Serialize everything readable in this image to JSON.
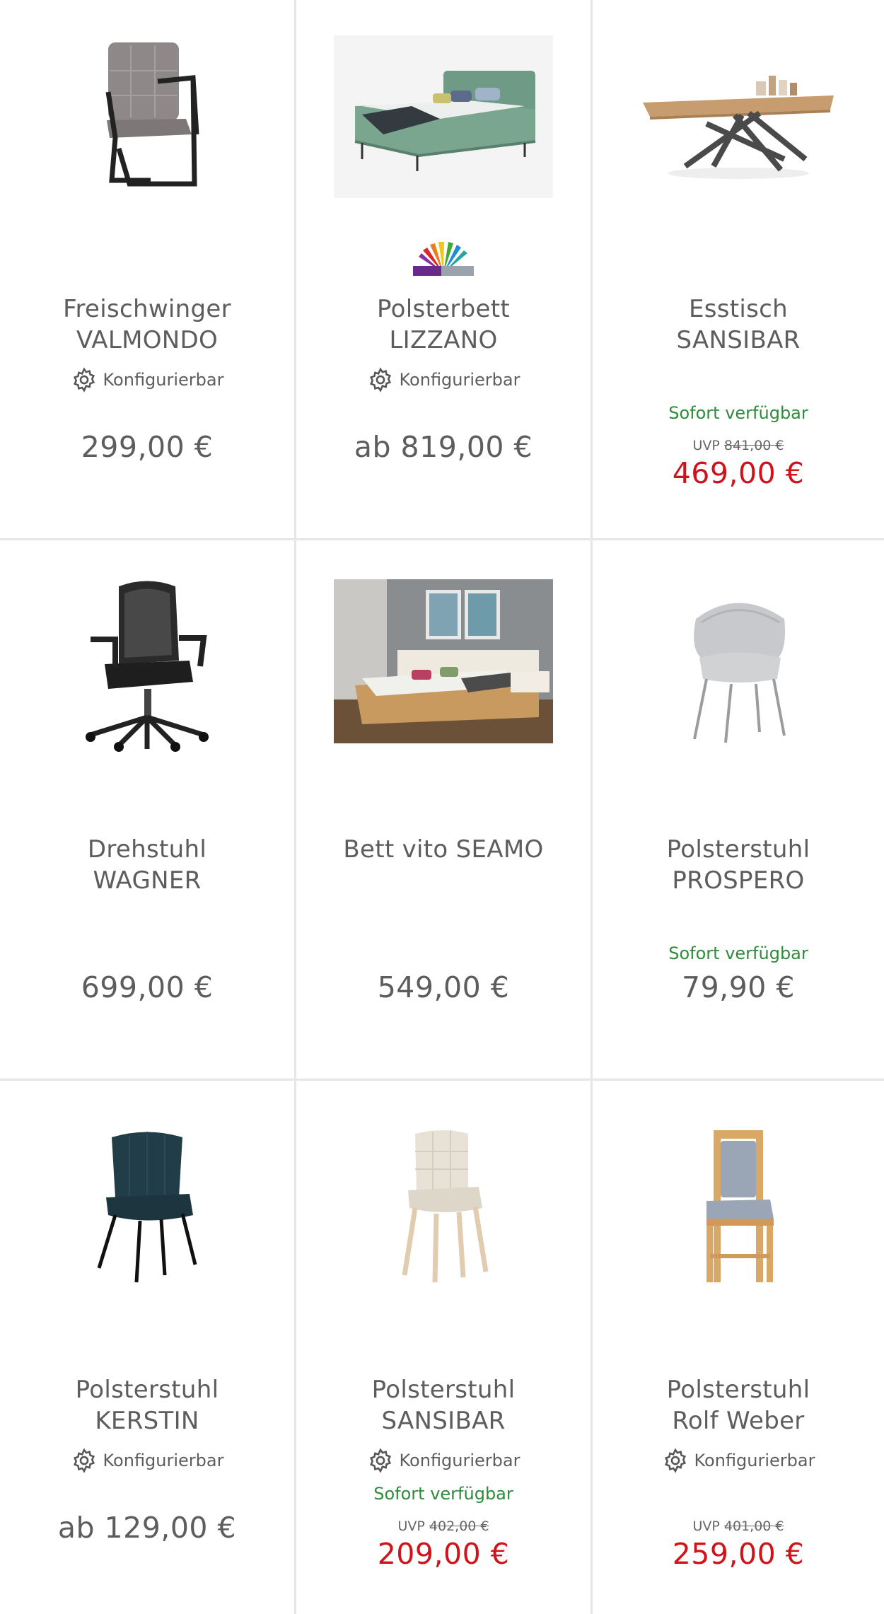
{
  "products": [
    {
      "title_line1": "Freischwinger",
      "title_line2": "VALMONDO",
      "configurable": "Konfigurierbar",
      "stock": "",
      "uvp_label": "",
      "uvp_price": "",
      "price": "299,00 €",
      "image": "cantilever-chair-image"
    },
    {
      "title_line1": "Polsterbett",
      "title_line2": "LIZZANO",
      "configurable": "Konfigurierbar",
      "stock": "",
      "uvp_label": "",
      "uvp_price": "",
      "price": "ab 819,00 €",
      "image": "upholstered-bed-image",
      "badge": "energy-label-logo"
    },
    {
      "title_line1": "Esstisch",
      "title_line2": "SANSIBAR",
      "configurable": "",
      "stock": "Sofort verfügbar",
      "uvp_label": "UVP",
      "uvp_price": "841,00 €",
      "price": "469,00 €",
      "image": "dining-table-image"
    },
    {
      "title_line1": "Drehstuhl",
      "title_line2": "WAGNER",
      "configurable": "",
      "stock": "",
      "uvp_label": "",
      "uvp_price": "",
      "price": "699,00 €",
      "image": "office-chair-image"
    },
    {
      "title_line1": "Bett vito SEAMO",
      "title_line2": "",
      "configurable": "",
      "stock": "",
      "uvp_label": "",
      "uvp_price": "",
      "price": "549,00 €",
      "image": "bedroom-photo-image"
    },
    {
      "title_line1": "Polsterstuhl",
      "title_line2": "PROSPERO",
      "configurable": "",
      "stock": "Sofort verfügbar",
      "uvp_label": "",
      "uvp_price": "",
      "price": "79,90 €",
      "image": "grey-armchair-image"
    },
    {
      "title_line1": "Polsterstuhl",
      "title_line2": "KERSTIN",
      "configurable": "Konfigurierbar",
      "stock": "",
      "uvp_label": "",
      "uvp_price": "",
      "price": "ab 129,00 €",
      "image": "velvet-chair-image"
    },
    {
      "title_line1": "Polsterstuhl",
      "title_line2": "SANSIBAR",
      "configurable": "Konfigurierbar",
      "stock": "Sofort verfügbar",
      "uvp_label": "UVP",
      "uvp_price": "402,00 €",
      "price": "209,00 €",
      "image": "beige-chair-image"
    },
    {
      "title_line1": "Polsterstuhl",
      "title_line2": "Rolf Weber",
      "configurable": "Konfigurierbar",
      "stock": "",
      "uvp_label": "UVP",
      "uvp_price": "401,00 €",
      "price": "259,00 €",
      "image": "wooden-chair-image"
    }
  ],
  "colors": {
    "stock_green": "#2e8b3c",
    "sale_red": "#d0121b",
    "text_grey": "#5d5d5d",
    "divider": "#e6e6e6"
  }
}
